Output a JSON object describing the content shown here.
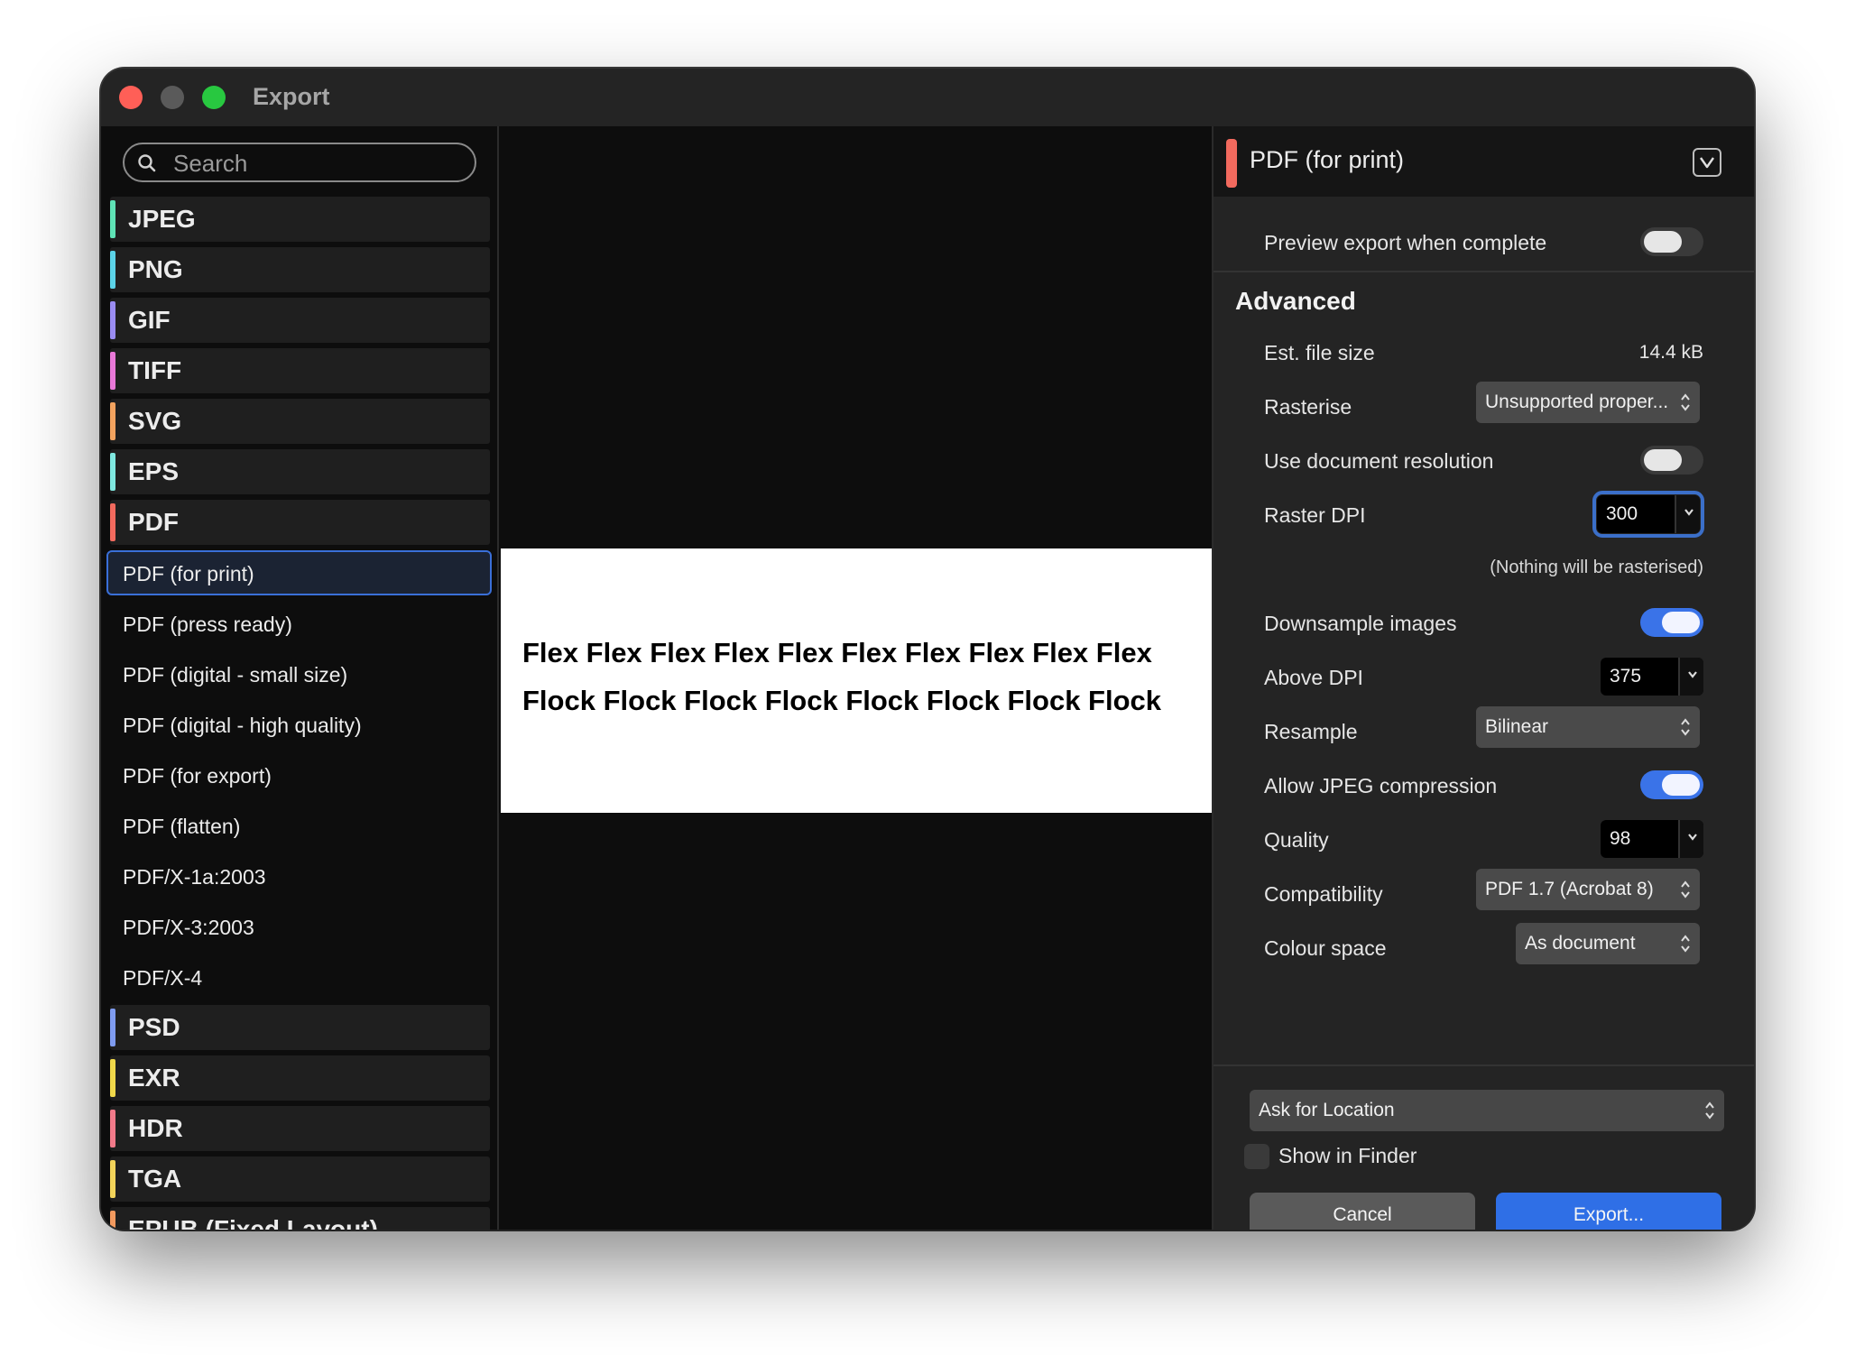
{
  "window": {
    "title": "Export"
  },
  "search": {
    "placeholder": "Search"
  },
  "formats": [
    {
      "type": "group",
      "label": "JPEG",
      "color": "#5fe3b6"
    },
    {
      "type": "group",
      "label": "PNG",
      "color": "#5bd3e8"
    },
    {
      "type": "group",
      "label": "GIF",
      "color": "#9a8cf2"
    },
    {
      "type": "group",
      "label": "TIFF",
      "color": "#e978d8"
    },
    {
      "type": "group",
      "label": "SVG",
      "color": "#f3a35f"
    },
    {
      "type": "group",
      "label": "EPS",
      "color": "#7fe8e0"
    },
    {
      "type": "group",
      "label": "PDF",
      "color": "#f26a5e"
    },
    {
      "type": "sub",
      "label": "PDF (for print)",
      "selected": true
    },
    {
      "type": "sub",
      "label": "PDF (press ready)"
    },
    {
      "type": "sub",
      "label": "PDF (digital - small size)"
    },
    {
      "type": "sub",
      "label": "PDF (digital - high quality)"
    },
    {
      "type": "sub",
      "label": "PDF (for export)"
    },
    {
      "type": "sub",
      "label": "PDF (flatten)"
    },
    {
      "type": "sub",
      "label": "PDF/X-1a:2003"
    },
    {
      "type": "sub",
      "label": "PDF/X-3:2003"
    },
    {
      "type": "sub",
      "label": "PDF/X-4"
    },
    {
      "type": "group",
      "label": "PSD",
      "color": "#7f9cf0"
    },
    {
      "type": "group",
      "label": "EXR",
      "color": "#f0d84a"
    },
    {
      "type": "group",
      "label": "HDR",
      "color": "#f27a8a"
    },
    {
      "type": "group",
      "label": "TGA",
      "color": "#f3d45a"
    },
    {
      "type": "group",
      "label": "EPUB (Fixed Layout)",
      "color": "#f39a5f"
    }
  ],
  "preview": {
    "line1": "Flex Flex Flex Flex Flex Flex Flex Flex Flex Flex",
    "line2": "Flock Flock Flock Flock Flock Flock Flock Flock"
  },
  "panel": {
    "preset_title": "PDF (for print)",
    "accent_color": "#f26a5e",
    "preview_when_complete_label": "Preview export when complete",
    "preview_when_complete": false,
    "advanced_title": "Advanced",
    "est_file_size_label": "Est. file size",
    "est_file_size_value": "14.4 kB",
    "rasterise_label": "Rasterise",
    "rasterise_value": "Unsupported proper...",
    "use_doc_res_label": "Use document resolution",
    "use_doc_res": false,
    "raster_dpi_label": "Raster DPI",
    "raster_dpi_value": "300",
    "raster_hint": "(Nothing will be rasterised)",
    "downsample_label": "Downsample images",
    "downsample": true,
    "above_dpi_label": "Above DPI",
    "above_dpi_value": "375",
    "resample_label": "Resample",
    "resample_value": "Bilinear",
    "allow_jpeg_label": "Allow JPEG compression",
    "allow_jpeg": true,
    "quality_label": "Quality",
    "quality_value": "98",
    "compatibility_label": "Compatibility",
    "compatibility_value": "PDF 1.7 (Acrobat 8)",
    "colour_space_label": "Colour space",
    "colour_space_value": "As document"
  },
  "footer": {
    "location_value": "Ask for Location",
    "show_in_finder_label": "Show in Finder",
    "show_in_finder": false,
    "cancel_label": "Cancel",
    "export_label": "Export..."
  }
}
